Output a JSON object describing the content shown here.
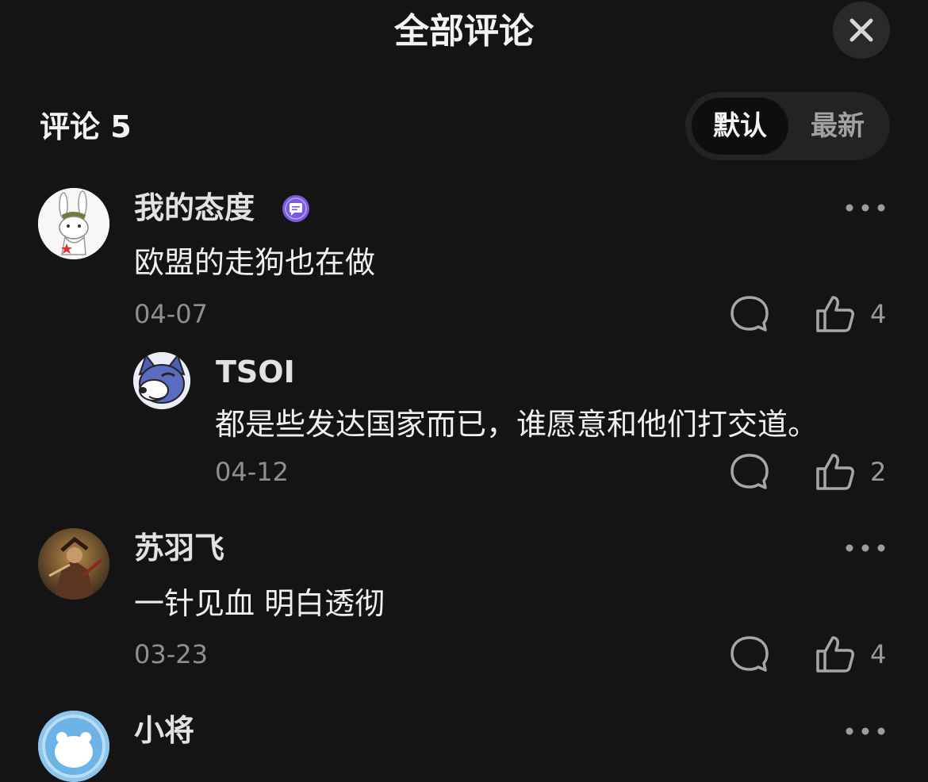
{
  "header": {
    "title": "全部评论",
    "close_icon": "close-icon"
  },
  "comments_header": {
    "title": "评论 5",
    "sort_options": [
      {
        "label": "默认",
        "active": true
      },
      {
        "label": "最新",
        "active": false
      }
    ]
  },
  "comments": [
    {
      "username": "我的态度",
      "badge_icon": "message-badge-icon",
      "text": "欧盟的走狗也在做",
      "date": "04-07",
      "likes": "4",
      "replies": [
        {
          "username": "TSOI",
          "text": "都是些发达国家而已，谁愿意和他们打交道。",
          "date": "04-12",
          "likes": "2"
        }
      ]
    },
    {
      "username": "苏羽飞",
      "text": "一针见血 明白透彻",
      "date": "03-23",
      "likes": "4"
    },
    {
      "username": "小将"
    }
  ],
  "colors": {
    "background": "#141414",
    "badge_purple": "#7a5ae0",
    "muted_text": "#8f8f8f"
  }
}
